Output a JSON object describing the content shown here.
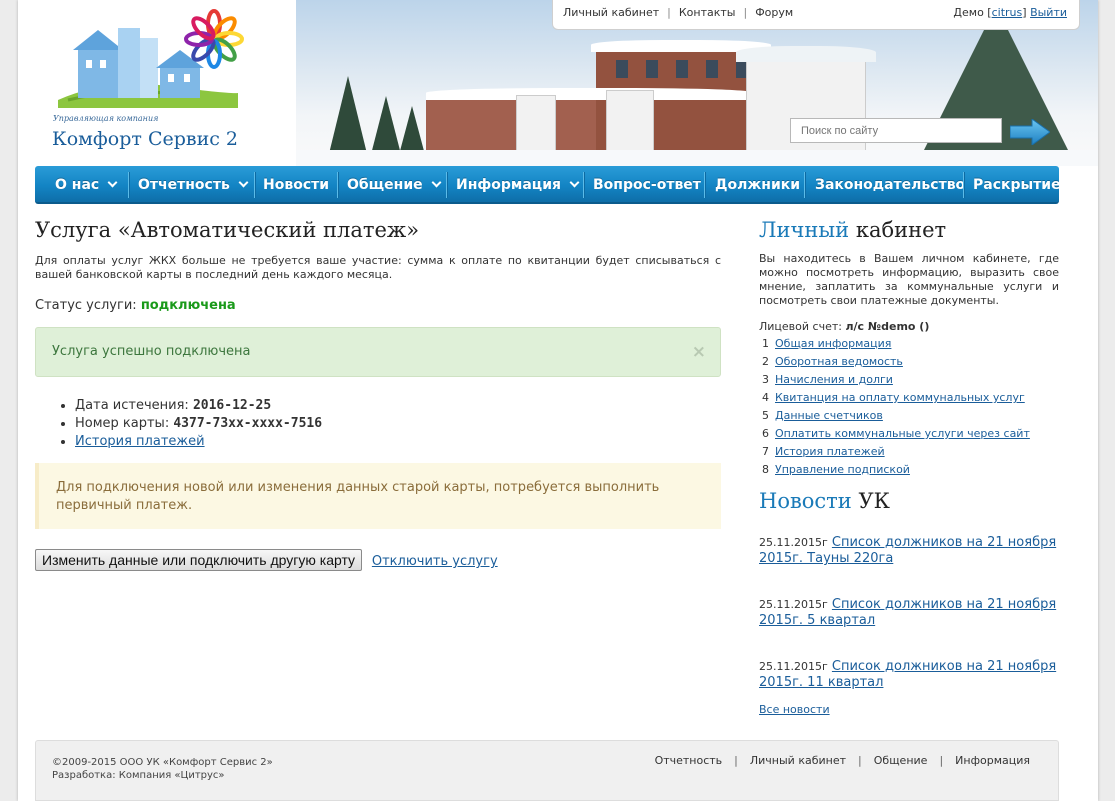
{
  "toplinks": {
    "items": [
      "Личный кабинет",
      "Контакты",
      "Форум"
    ],
    "sep": "|",
    "user_prefix": "Демо [",
    "user_login": "citrus",
    "user_suffix": "]",
    "logout": "Выйти"
  },
  "search": {
    "placeholder": "Поиск по сайту"
  },
  "logo": {
    "subtitle": "Управляющая компания",
    "title": "Комфорт Сервис 2"
  },
  "nav": {
    "items": [
      {
        "label": "О нас"
      },
      {
        "label": "Отчетность"
      },
      {
        "label": "Новости"
      },
      {
        "label": "Общение"
      },
      {
        "label": "Информация"
      },
      {
        "label": "Вопрос-ответ"
      },
      {
        "label": "Должники"
      },
      {
        "label": "Законодательство"
      },
      {
        "label": "Раскрытие и"
      }
    ]
  },
  "main": {
    "title": "Услуга «Автоматический платеж»",
    "intro": "Для оплаты услуг ЖКХ больше не требуется ваше участие: сумма к оплате по квитанции будет списываться с вашей банковской карты в последний день каждого месяца.",
    "status_label": "Статус услуги:",
    "status_value": "подключена",
    "alert": "Услуга успешно подключена",
    "alert_close": "×",
    "expiry_label": "Дата истечения:",
    "expiry_value": "2016-12-25",
    "card_label": "Номер карты:",
    "card_value": "4377-73xx-xxxx-7516",
    "history_link": "История платежей",
    "warning": "Для подключения новой или изменения данных старой карты, потребуется выполнить первичный платеж.",
    "change_button": "Изменить данные или подключить другую карту",
    "disconnect_link": "Отключить услугу"
  },
  "sidebar": {
    "cabinet_title_a": "Личный",
    "cabinet_title_b": "кабинет",
    "cabinet_text": "Вы находитесь в Вашем личном кабинете, где можно посмотреть информацию, выразить свое мнение, заплатить за коммунальные услуги и посмотреть свои платежные документы.",
    "account_label": "Лицевой счет:",
    "account_value": "л/с №demo ()",
    "menu": [
      {
        "n": "1",
        "label": "Общая информация"
      },
      {
        "n": "2",
        "label": "Оборотная ведомость"
      },
      {
        "n": "3",
        "label": "Начисления и долги"
      },
      {
        "n": "4",
        "label": "Квитанция на оплату коммунальных услуг"
      },
      {
        "n": "5",
        "label": "Данные счетчиков"
      },
      {
        "n": "6",
        "label": "Оплатить коммунальные услуги через сайт"
      },
      {
        "n": "7",
        "label": "История платежей"
      },
      {
        "n": "8",
        "label": "Управление подпиской"
      }
    ],
    "news_title_a": "Новости",
    "news_title_b": "УК",
    "news": [
      {
        "date": "25.11.2015г",
        "title": "Список должников на 21 ноября 2015г. Тауны 220га"
      },
      {
        "date": "25.11.2015г",
        "title": "Список должников на 21 ноября 2015г. 5 квартал"
      },
      {
        "date": "25.11.2015г",
        "title": "Список должников на 21 ноября 2015г. 11 квартал"
      }
    ],
    "all_news": "Все новости"
  },
  "footer": {
    "copyright": "©2009-2015 ООО УК «Комфорт Сервис 2»",
    "developer": "Разработка: Компания «Цитрус»",
    "links": [
      "Отчетность",
      "Личный кабинет",
      "Общение",
      "Информация"
    ],
    "sep": "|"
  },
  "colors": {
    "nav": "#1384c4",
    "accent": "#1a7ab8",
    "success": "#dff0d8",
    "warning": "#fcf8e3",
    "status": "#1a9a1a"
  }
}
